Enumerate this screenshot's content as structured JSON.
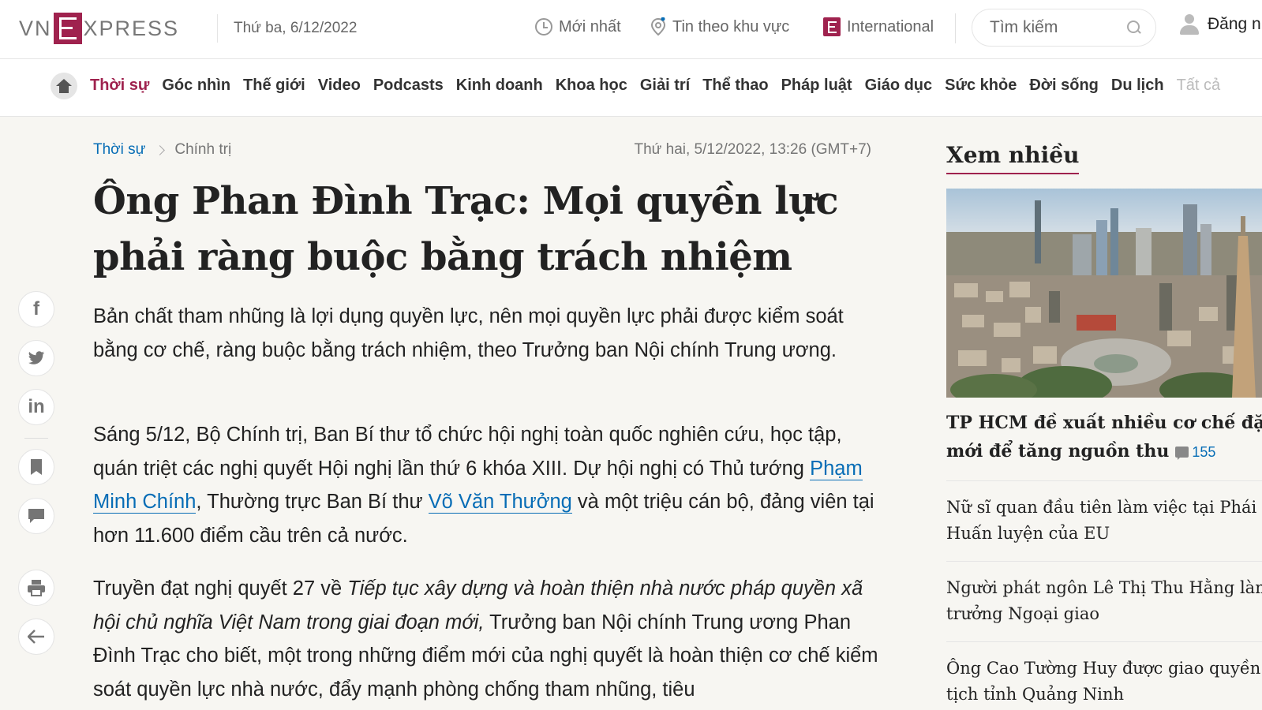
{
  "header": {
    "logo_left": "VN",
    "logo_right": "XPRESS",
    "date": "Thứ ba, 6/12/2022",
    "links": {
      "latest": "Mới nhất",
      "regional": "Tin theo khu vực",
      "international": "International"
    },
    "search_placeholder": "Tìm kiếm",
    "login": "Đăng nhập"
  },
  "categories": [
    "Thời sự",
    "Góc nhìn",
    "Thế giới",
    "Video",
    "Podcasts",
    "Kinh doanh",
    "Khoa học",
    "Giải trí",
    "Thể thao",
    "Pháp luật",
    "Giáo dục",
    "Sức khỏe",
    "Đời sống",
    "Du lịch",
    "Tất cả"
  ],
  "active_category": "Thời sự",
  "article": {
    "breadcrumb": [
      "Thời sự",
      "Chính trị"
    ],
    "date": "Thứ hai, 5/12/2022, 13:26 (GMT+7)",
    "title": "Ông Phan Đình Trạc: Mọi quyền lực phải ràng buộc bằng trách nhiệm",
    "lead": "Bản chất tham nhũng là lợi dụng quyền lực, nên mọi quyền lực phải được kiểm soát bằng cơ chế, ràng buộc bằng trách nhiệm, theo Trưởng ban Nội chính Trung ương.",
    "p1": {
      "before": "Sáng 5/12, Bộ Chính trị, Ban Bí thư tổ chức hội nghị toàn quốc nghiên cứu, học tập, quán triệt các nghị quyết Hội nghị lần thứ 6 khóa XIII. Dự hội nghị có Thủ tướng ",
      "link1": "Phạm Minh Chính",
      "middle": ", Thường trực Ban Bí thư ",
      "link2": "Võ Văn Thưởng",
      "after": " và một triệu cán bộ, đảng viên tại hơn 11.600 điểm cầu trên cả nước."
    },
    "p2": {
      "before": "Truyền đạt nghị quyết 27 về ",
      "italic": "Tiếp tục xây dựng và hoàn thiện nhà nước pháp quyền xã hội chủ nghĩa Việt Nam trong giai đoạn mới,",
      "after": " Trưởng ban Nội chính Trung ương Phan Đình Trạc cho biết, một trong những điểm mới của nghị quyết là hoàn thiện cơ chế kiểm soát quyền lực nhà nước, đẩy mạnh phòng chống tham nhũng, tiêu"
    }
  },
  "sidebar": {
    "title": "Xem nhiều",
    "top_story": "TP HCM đề xuất nhiều cơ chế đặc thù mới để tăng nguồn thu",
    "top_story_line1": "TP HCM đề xuất nhiều cơ chế đặc thù",
    "top_story_line2": "mới để tăng nguồn thu",
    "top_story_comments": "155",
    "items": [
      {
        "line1": "Nữ sĩ quan đầu tiên làm việc tại Phái bộ",
        "line2": "Huấn luyện của EU"
      },
      {
        "line1": "Người phát ngôn Lê Thị Thu Hằng làm Thứ",
        "line2": "trưởng Ngoại giao"
      },
      {
        "line1": "Ông Cao Tường Huy được giao quyền Chủ",
        "line2": "tịch tỉnh Quảng Ninh"
      }
    ]
  },
  "social": {
    "facebook": "f",
    "linkedin": "in"
  },
  "colors": {
    "brand": "#9f224e",
    "link": "#076db6",
    "bg": "#f7f6f2"
  }
}
